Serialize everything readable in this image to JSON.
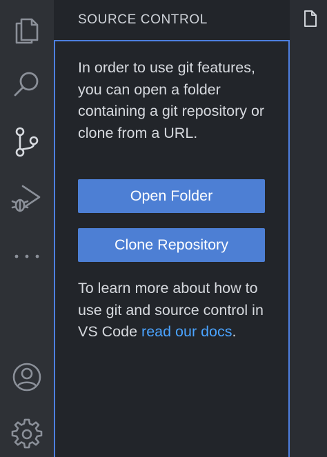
{
  "activity_bar": {
    "items": [
      {
        "name": "explorer",
        "icon": "files-icon"
      },
      {
        "name": "search",
        "icon": "search-icon"
      },
      {
        "name": "source-control",
        "icon": "source-control-icon",
        "active": true
      },
      {
        "name": "run-and-debug",
        "icon": "run-debug-icon"
      },
      {
        "name": "more",
        "icon": "ellipsis-icon"
      }
    ],
    "bottom_items": [
      {
        "name": "accounts",
        "icon": "account-icon"
      },
      {
        "name": "manage",
        "icon": "gear-icon"
      }
    ]
  },
  "sidebar": {
    "title": "SOURCE CONTROL",
    "welcome_intro": "In order to use git features, you can open a folder containing a git repository or clone from a URL.",
    "open_folder_label": "Open Folder",
    "clone_repository_label": "Clone Repository",
    "learn_more_prefix": "To learn more about how to use git and source control in VS Code ",
    "learn_more_link": "read our docs",
    "learn_more_suffix": "."
  },
  "editor": {
    "tab_icon": "file-icon"
  },
  "colors": {
    "activity_bar_bg": "#2e3136",
    "sidebar_bg": "#22252a",
    "focus_border": "#4d7fe0",
    "button_bg": "#4d7fd4",
    "link": "#4aa3ff",
    "text": "#d6d9de"
  }
}
